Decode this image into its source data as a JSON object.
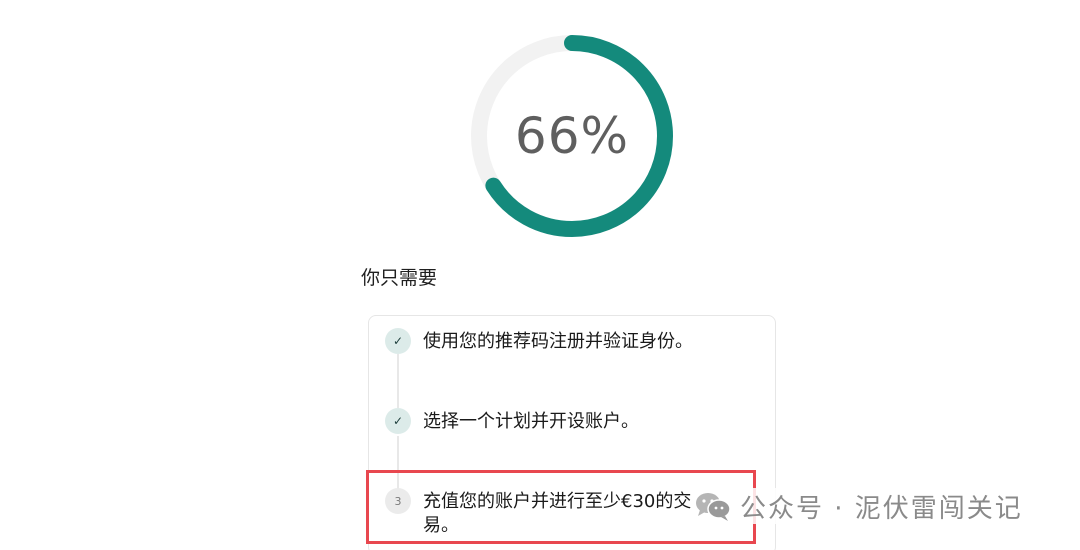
{
  "progress": {
    "value": 66,
    "label": "66%",
    "track_color": "#f2f2f2",
    "fill_color": "#148a7c"
  },
  "section": {
    "title": "你只需要"
  },
  "steps": [
    {
      "badge": "✓",
      "text": "使用您的推荐码注册并验证身份。",
      "status": "done"
    },
    {
      "badge": "✓",
      "text": "选择一个计划并开设账户。",
      "status": "done"
    },
    {
      "badge": "3",
      "text": "充值您的账户并进行至少€30的交易。",
      "status": "pending"
    }
  ],
  "highlight": {
    "color": "#e8474f"
  },
  "watermark": {
    "icon": "wechat-icon",
    "text": "公众号 · 泥伏雷闯关记"
  }
}
